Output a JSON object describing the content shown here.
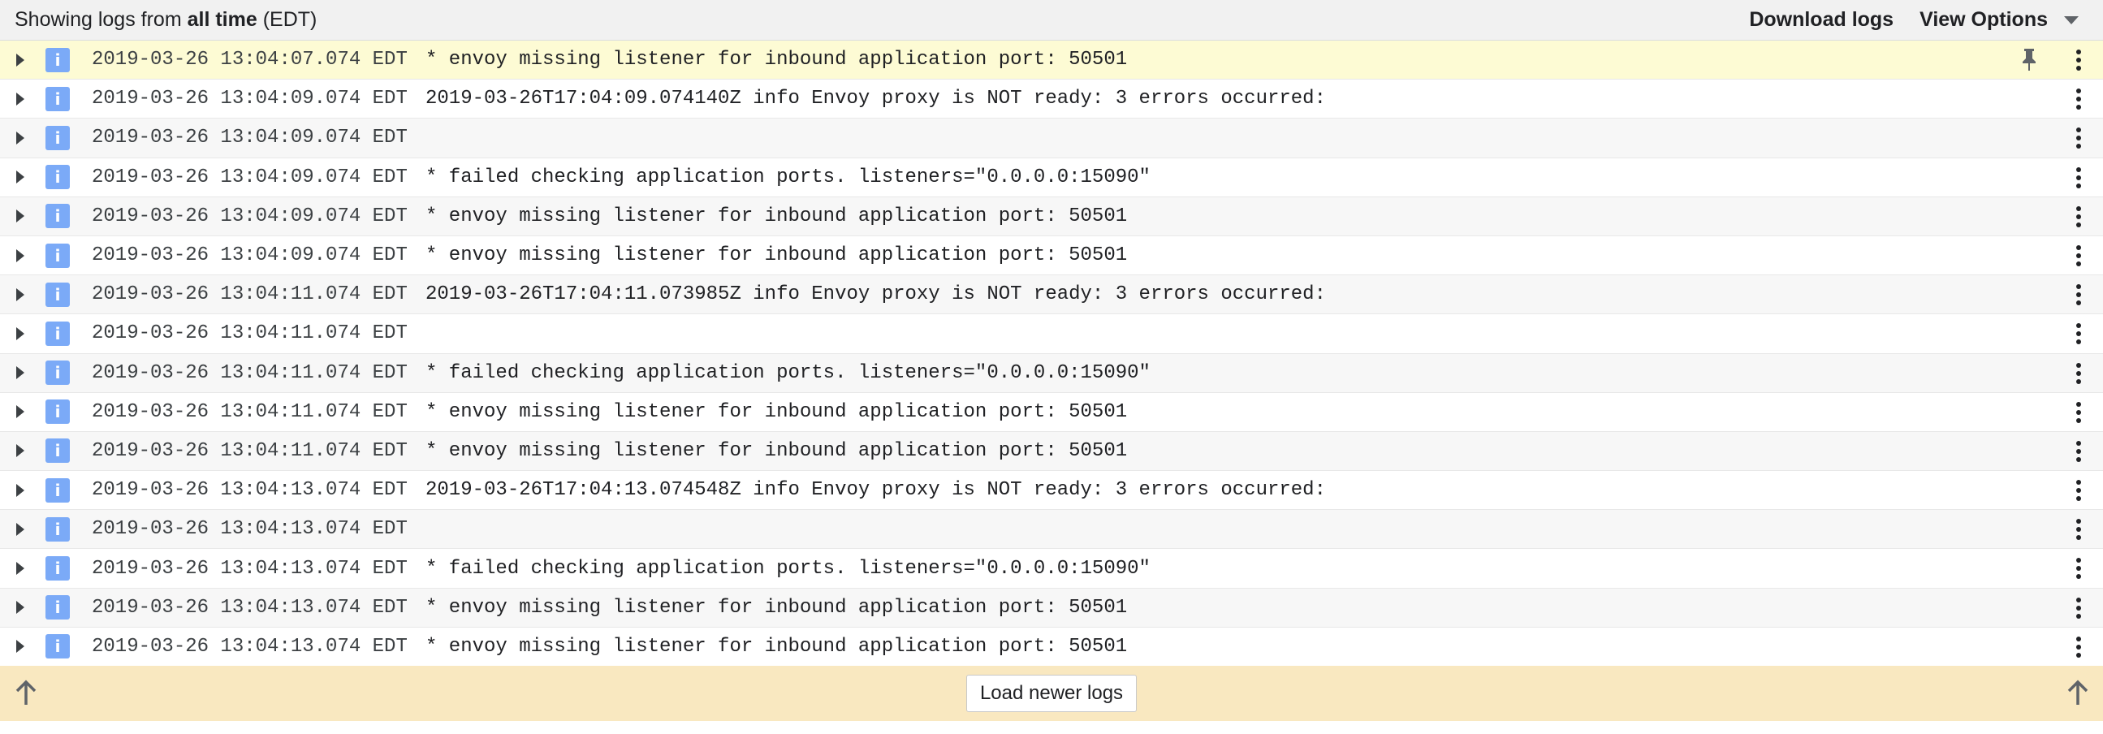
{
  "toolbar": {
    "prefix": "Showing logs from ",
    "range": "all time",
    "timezone": " (EDT)",
    "download_label": "Download logs",
    "view_options_label": "View Options"
  },
  "severity_label": "i",
  "logs": [
    {
      "timestamp": "2019-03-26 13:04:07.074 EDT",
      "message": "* envoy missing listener for inbound application port: 50501",
      "pinned": true
    },
    {
      "timestamp": "2019-03-26 13:04:09.074 EDT",
      "message": "2019-03-26T17:04:09.074140Z info Envoy proxy is NOT ready: 3 errors occurred:"
    },
    {
      "timestamp": "2019-03-26 13:04:09.074 EDT",
      "message": ""
    },
    {
      "timestamp": "2019-03-26 13:04:09.074 EDT",
      "message": "* failed checking application ports. listeners=\"0.0.0.0:15090\""
    },
    {
      "timestamp": "2019-03-26 13:04:09.074 EDT",
      "message": "* envoy missing listener for inbound application port: 50501"
    },
    {
      "timestamp": "2019-03-26 13:04:09.074 EDT",
      "message": "* envoy missing listener for inbound application port: 50501"
    },
    {
      "timestamp": "2019-03-26 13:04:11.074 EDT",
      "message": "2019-03-26T17:04:11.073985Z info Envoy proxy is NOT ready: 3 errors occurred:"
    },
    {
      "timestamp": "2019-03-26 13:04:11.074 EDT",
      "message": ""
    },
    {
      "timestamp": "2019-03-26 13:04:11.074 EDT",
      "message": "* failed checking application ports. listeners=\"0.0.0.0:15090\""
    },
    {
      "timestamp": "2019-03-26 13:04:11.074 EDT",
      "message": "* envoy missing listener for inbound application port: 50501"
    },
    {
      "timestamp": "2019-03-26 13:04:11.074 EDT",
      "message": "* envoy missing listener for inbound application port: 50501"
    },
    {
      "timestamp": "2019-03-26 13:04:13.074 EDT",
      "message": "2019-03-26T17:04:13.074548Z info Envoy proxy is NOT ready: 3 errors occurred:"
    },
    {
      "timestamp": "2019-03-26 13:04:13.074 EDT",
      "message": ""
    },
    {
      "timestamp": "2019-03-26 13:04:13.074 EDT",
      "message": "* failed checking application ports. listeners=\"0.0.0.0:15090\""
    },
    {
      "timestamp": "2019-03-26 13:04:13.074 EDT",
      "message": "* envoy missing listener for inbound application port: 50501"
    },
    {
      "timestamp": "2019-03-26 13:04:13.074 EDT",
      "message": "* envoy missing listener for inbound application port: 50501"
    }
  ],
  "footer": {
    "load_newer_label": "Load newer logs"
  },
  "colors": {
    "highlight_row": "#fdfbd4",
    "severity_info": "#7baaf7",
    "footer_bg": "#f9e8c0"
  }
}
